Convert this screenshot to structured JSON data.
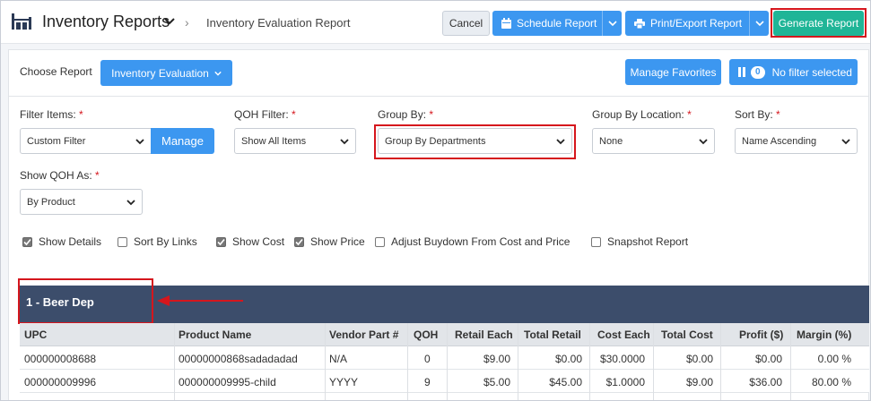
{
  "header": {
    "app_title": "Inventory Reports",
    "breadcrumb": "Inventory Evaluation Report",
    "cancel_label": "Cancel",
    "schedule_label": "Schedule Report",
    "print_label": "Print/Export Report",
    "generate_label": "Generate Report"
  },
  "toolbar": {
    "choose_report_label": "Choose Report",
    "report_value": "Inventory Evaluation",
    "manage_favorites_label": "Manage Favorites",
    "filter_count": "0",
    "filter_label": "No filter selected"
  },
  "filters": {
    "filter_items": {
      "label": "Filter Items:",
      "value": "Custom Filter",
      "manage_label": "Manage"
    },
    "qoh_filter": {
      "label": "QOH Filter:",
      "value": "Show All Items"
    },
    "group_by": {
      "label": "Group By:",
      "value": "Group By Departments"
    },
    "group_by_location": {
      "label": "Group By Location:",
      "value": "None"
    },
    "sort_by": {
      "label": "Sort By:",
      "value": "Name Ascending"
    },
    "show_qoh_as": {
      "label": "Show QOH As:",
      "value": "By Product"
    },
    "required_mark": "*"
  },
  "options": [
    {
      "label": "Show Details",
      "checked": true
    },
    {
      "label": "Sort By Links",
      "checked": false
    },
    {
      "label": "Show Cost",
      "checked": true
    },
    {
      "label": "Show Price",
      "checked": true
    },
    {
      "label": "Adjust Buydown From Cost and Price",
      "checked": false
    },
    {
      "label": "Snapshot Report",
      "checked": false
    }
  ],
  "report": {
    "department": "1 - Beer Dep",
    "columns": [
      "UPC",
      "Product Name",
      "Vendor Part #",
      "QOH",
      "Retail Each",
      "Total Retail",
      "Cost Each",
      "Total Cost",
      "Profit ($)",
      "Margin (%)"
    ],
    "rows": [
      [
        "000000008688",
        "00000000868sadadadad",
        "N/A",
        "0",
        "$9.00",
        "$0.00",
        "$30.0000",
        "$0.00",
        "$0.00",
        "0.00 %"
      ],
      [
        "000000009996",
        "000000009995-child",
        "YYYY",
        "9",
        "$5.00",
        "$45.00",
        "$1.0000",
        "$9.00",
        "$36.00",
        "80.00 %"
      ]
    ]
  },
  "colors": {
    "primary": "#3c97f0",
    "success": "#1fb597",
    "highlight": "#d5161d",
    "department_bar": "#3c4d6b"
  }
}
